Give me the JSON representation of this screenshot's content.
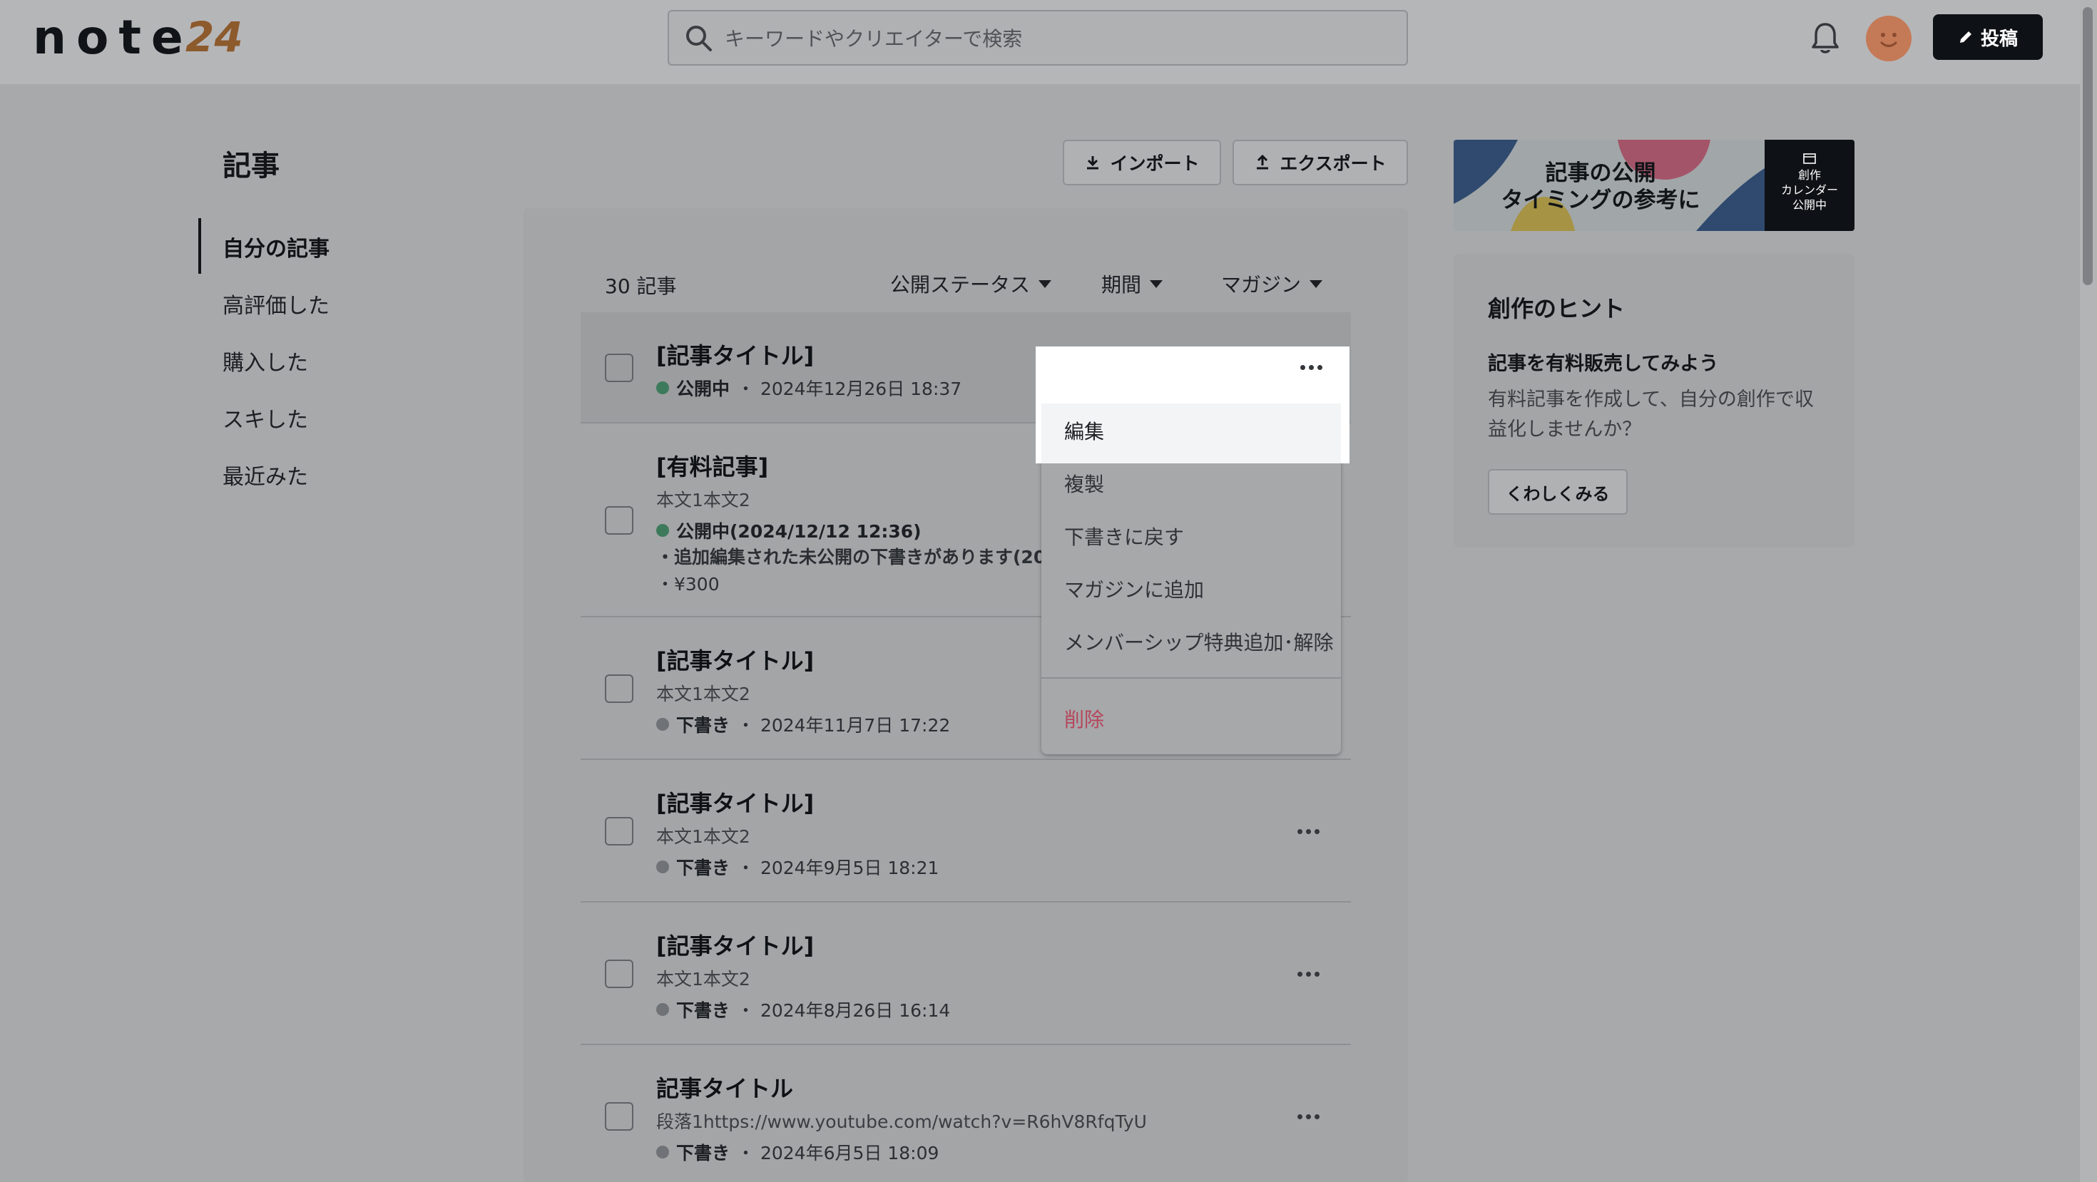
{
  "header": {
    "logo_text": "note",
    "logo_badge": "24",
    "search_placeholder": "キーワードやクリエイターで検索",
    "post_label": "投稿"
  },
  "sidebar": {
    "title": "記事",
    "items": [
      {
        "label": "自分の記事"
      },
      {
        "label": "高評価した"
      },
      {
        "label": "購入した"
      },
      {
        "label": "スキした"
      },
      {
        "label": "最近みた"
      }
    ]
  },
  "toolbar": {
    "import_label": "インポート",
    "export_label": "エクスポート"
  },
  "list": {
    "count": "30 記事",
    "filters": {
      "status": "公開ステータス",
      "period": "期間",
      "magazine": "マガジン"
    },
    "rows": [
      {
        "title": "[記事タイトル]",
        "status": "公開中",
        "meta": "・ 2024年12月26日 18:37"
      },
      {
        "title": "[有料記事]",
        "body": "本文1本文2",
        "status": "公開中(2024/12/12 12:36)",
        "note": "・追加編集された未公開の下書きがあります(2024",
        "price": "・¥300"
      },
      {
        "title": "[記事タイトル]",
        "body": "本文1本文2",
        "status": "下書き",
        "meta": "・ 2024年11月7日 17:22"
      },
      {
        "title": "[記事タイトル]",
        "body": "本文1本文2",
        "status": "下書き",
        "meta": "・ 2024年9月5日 18:21"
      },
      {
        "title": "[記事タイトル]",
        "body": "本文1本文2",
        "status": "下書き",
        "meta": "・ 2024年8月26日 16:14"
      },
      {
        "title": "記事タイトル",
        "body": "段落1https://www.youtube.com/watch?v=R6hV8RfqTyU",
        "status": "下書き",
        "meta": "・ 2024年6月5日 18:09"
      }
    ]
  },
  "menu": {
    "edit": "編集",
    "duplicate": "複製",
    "revert": "下書きに戻す",
    "add_magazine": "マガジンに追加",
    "membership": "メンバーシップ特典追加･解除",
    "delete": "削除"
  },
  "banner": {
    "line1": "記事の公開",
    "line2": "タイミングの参考に",
    "badge1": "創作",
    "badge2": "カレンダー",
    "badge3": "公開中"
  },
  "hint": {
    "title": "創作のヒント",
    "subtitle": "記事を有料販売してみよう",
    "body": "有料記事を作成して、自分の創作で収益化しませんか？",
    "button": "くわしくみる"
  },
  "colors": {
    "published_dot": "#3d7a5c",
    "draft_dot": "#6f7276",
    "delete_text": "#b5475c",
    "accent_dark": "#0e1115"
  }
}
